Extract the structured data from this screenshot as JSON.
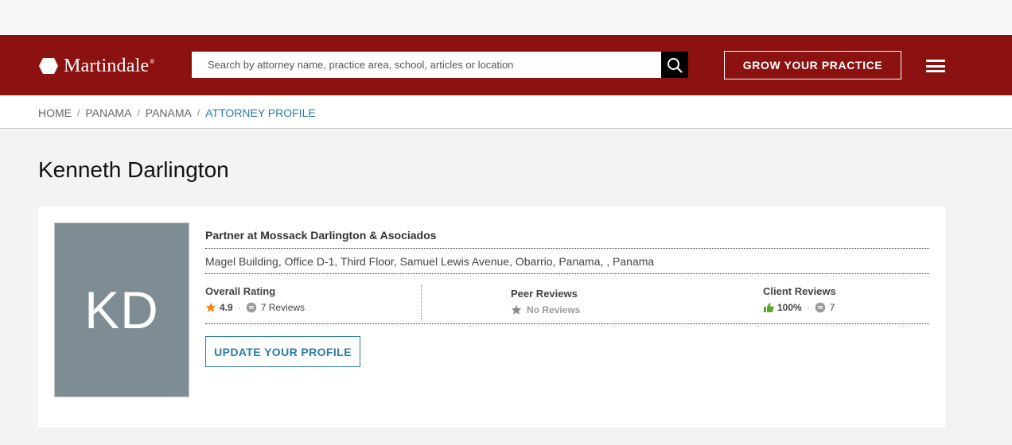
{
  "header": {
    "logo_text": "Martindale",
    "logo_reg": "®",
    "search_placeholder": "Search by attorney name, practice area, school, articles or location",
    "grow_label": "GROW YOUR PRACTICE",
    "icons": {
      "search": "search-icon",
      "menu": "hamburger-menu-icon",
      "logo": "hexagon-logo-icon"
    }
  },
  "breadcrumb": {
    "items": [
      "HOME",
      "PANAMA",
      "PANAMA"
    ],
    "current": "ATTORNEY PROFILE",
    "separator": "/"
  },
  "profile": {
    "name": "Kenneth Darlington",
    "initials": "KD",
    "role": "Partner at Mossack Darlington & Asociados",
    "address": "Magel Building, Office D-1, Third Floor, Samuel Lewis Avenue, Obarrio, Panama, , Panama",
    "overall": {
      "label": "Overall Rating",
      "score": "4.9",
      "reviews": "7 Reviews"
    },
    "peer": {
      "label": "Peer Reviews",
      "status": "No Reviews"
    },
    "client": {
      "label": "Client Reviews",
      "percent": "100%",
      "count": "7"
    },
    "update_label": "UPDATE YOUR PROFILE"
  },
  "colors": {
    "brand_red": "#8c1111",
    "link_blue": "#2a7bab",
    "avatar_bg": "#7e8c94",
    "star_orange": "#f0821e",
    "thumb_green": "#5ba829"
  }
}
